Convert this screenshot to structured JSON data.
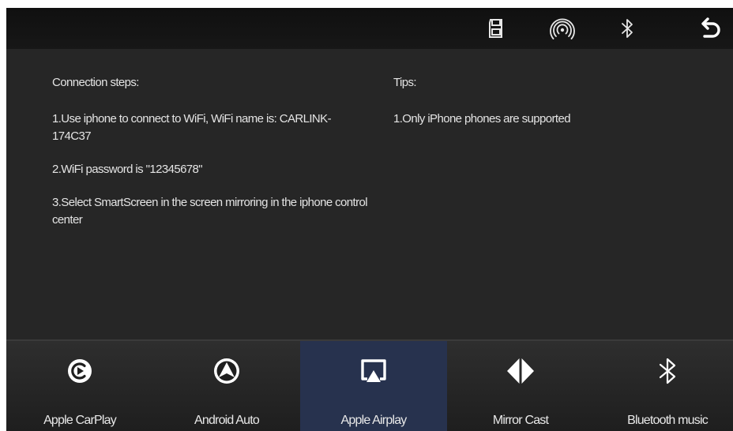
{
  "connection": {
    "heading": "Connection steps:",
    "steps": [
      "1.Use iphone to connect to WiFi, WiFi name is: CARLINK-174C37",
      "2.WiFi password is \"12345678\"",
      "3.Select SmartScreen in the screen mirroring in the iphone control center"
    ]
  },
  "tips": {
    "heading": "Tips:",
    "items": [
      "1.Only iPhone phones are supported"
    ]
  },
  "topbar": {
    "icons": [
      "sd-card-icon",
      "signal-icon",
      "bluetooth-icon",
      "back-icon"
    ]
  },
  "nav": {
    "active": "Apple Airplay",
    "items": [
      {
        "label": "Apple CarPlay",
        "icon": "carplay-icon"
      },
      {
        "label": "Android Auto",
        "icon": "android-auto-icon"
      },
      {
        "label": "Apple Airplay",
        "icon": "airplay-icon"
      },
      {
        "label": "Mirror Cast",
        "icon": "mirror-cast-icon"
      },
      {
        "label": "Bluetooth music",
        "icon": "bluetooth-music-icon"
      }
    ]
  },
  "colors": {
    "background": "#222222",
    "topbar": "#141414",
    "active_tab": "#27324e",
    "text": "#e4e4e4"
  }
}
